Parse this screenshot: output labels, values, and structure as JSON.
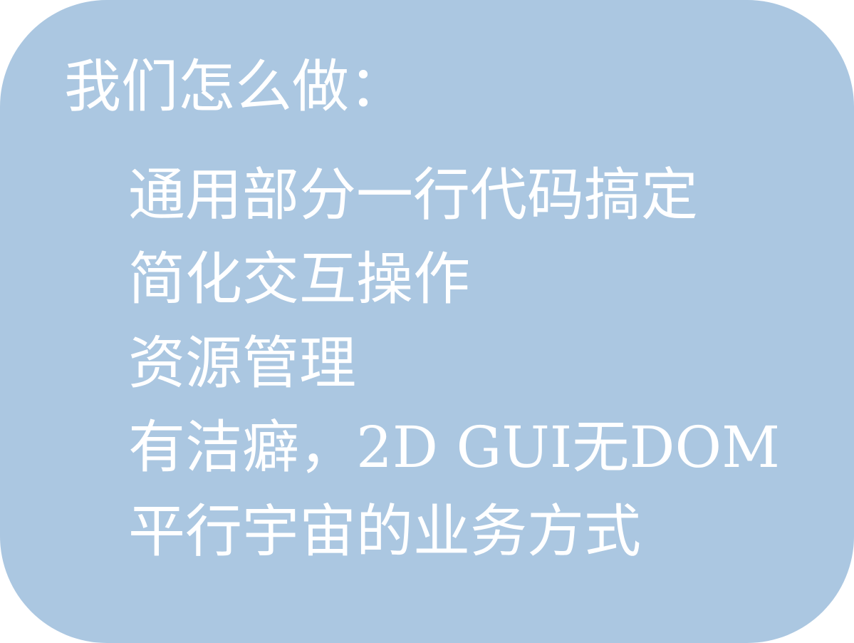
{
  "card": {
    "background_color": "#abc7e1",
    "text_color": "#ffffff",
    "heading": "我们怎么做：",
    "items": [
      "通用部分一行代码搞定",
      "简化交互操作",
      "资源管理",
      "有洁癖，2D GUI无DOM",
      "平行宇宙的业务方式"
    ]
  }
}
